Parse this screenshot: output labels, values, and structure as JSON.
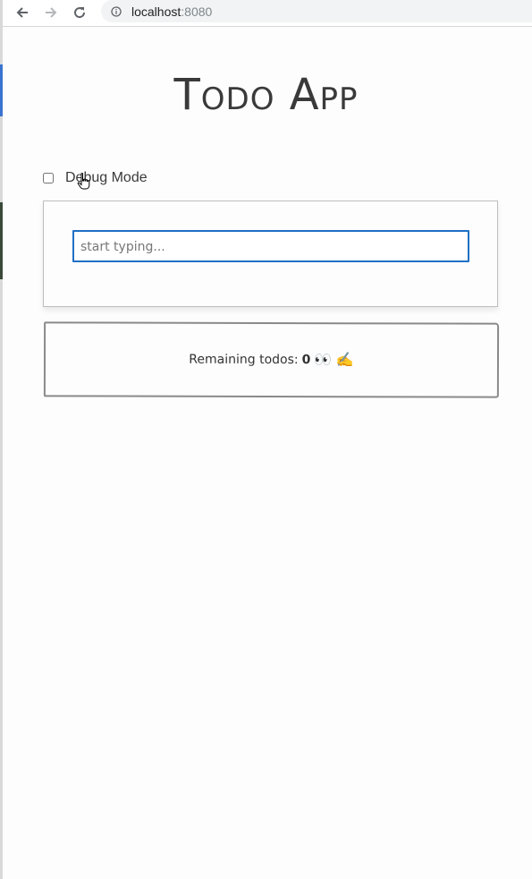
{
  "browser": {
    "url_host": "localhost",
    "url_port": ":8080"
  },
  "page": {
    "title": "Todo App"
  },
  "debug": {
    "label": "Debug Mode",
    "checked": false
  },
  "todo_input": {
    "placeholder": "start typing...",
    "value": ""
  },
  "remaining": {
    "label": "Remaining todos:",
    "count": "0",
    "emoji": "👀 ✍️"
  },
  "colors": {
    "input_border": "#1f6fc4",
    "title": "#3a3a3a"
  },
  "icons": {
    "back": "back-arrow-icon",
    "forward": "forward-arrow-icon",
    "reload": "reload-icon",
    "info": "info-icon",
    "cursor": "hand-pointer-icon"
  }
}
